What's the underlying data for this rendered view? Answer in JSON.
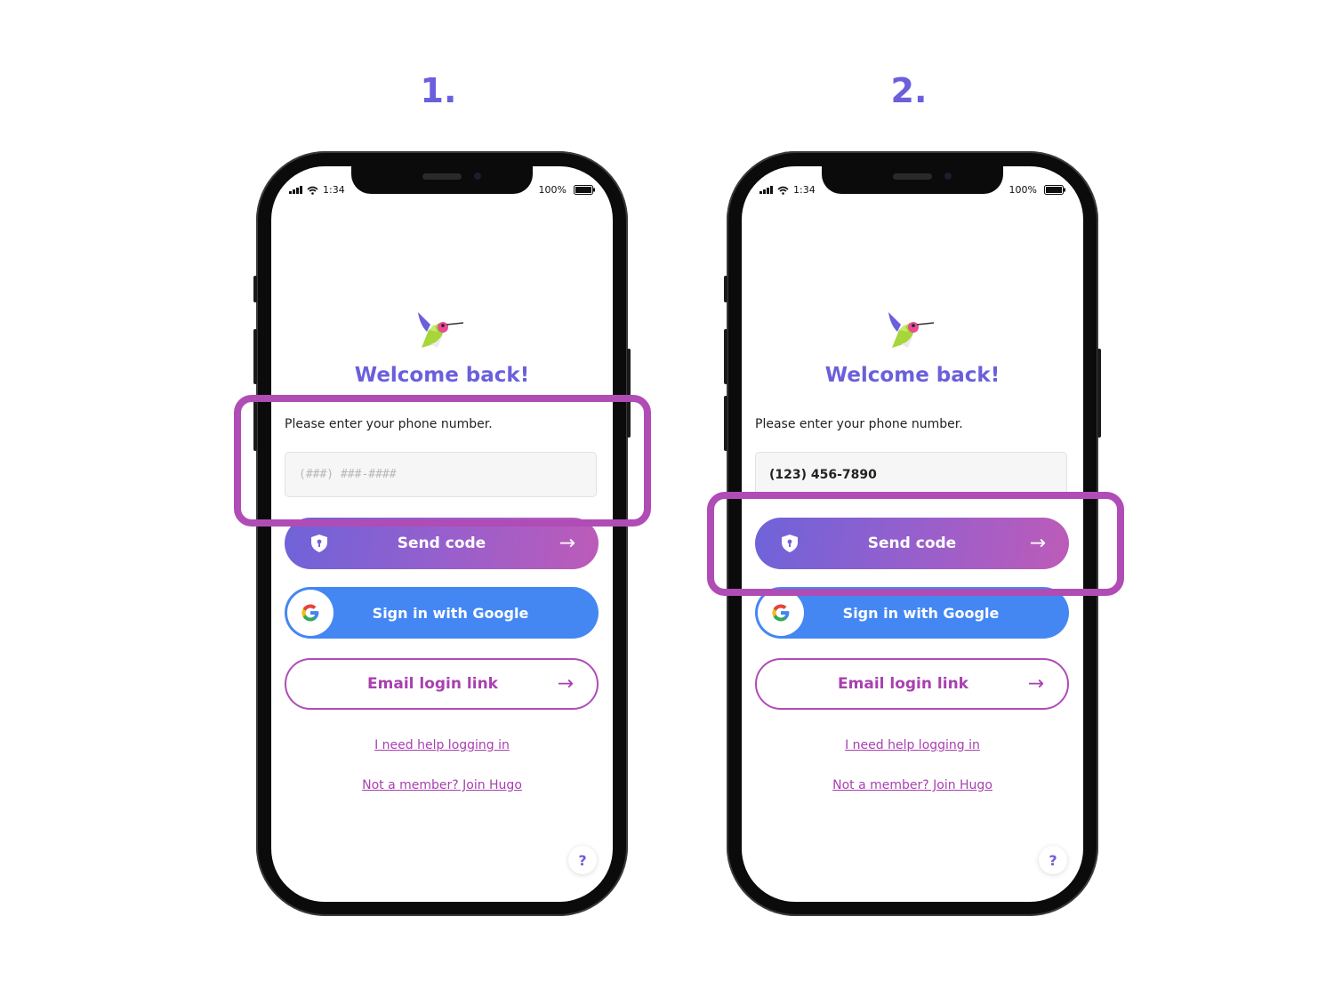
{
  "steps": [
    "1.",
    "2."
  ],
  "colors": {
    "accent": "#6b5fdc",
    "highlight": "#b04cb5",
    "google_blue": "#4487f3",
    "link": "#a840b0"
  },
  "phones": [
    {
      "status": {
        "time": "1:34",
        "battery": "100%"
      },
      "title": "Welcome back!",
      "phone_label": "Please enter your phone number.",
      "phone_input": {
        "value": "",
        "placeholder": "(###) ###-####"
      },
      "send_code": "Send code",
      "google": "Sign in with Google",
      "email": "Email login link",
      "help_link": "I need help logging in",
      "join_link": "Not a member? Join Hugo",
      "help_button": "?",
      "highlighted": "phone-input"
    },
    {
      "status": {
        "time": "1:34",
        "battery": "100%"
      },
      "title": "Welcome back!",
      "phone_label": "Please enter your phone number.",
      "phone_input": {
        "value": "(123) 456-7890",
        "placeholder": "(###) ###-####"
      },
      "send_code": "Send code",
      "google": "Sign in with Google",
      "email": "Email login link",
      "help_link": "I need help logging in",
      "join_link": "Not a member? Join Hugo",
      "help_button": "?",
      "highlighted": "send-code-button"
    }
  ]
}
